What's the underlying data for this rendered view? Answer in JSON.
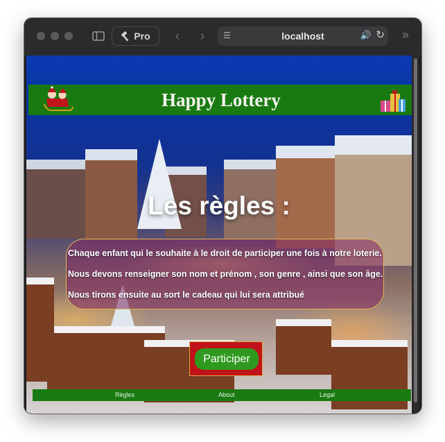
{
  "browser": {
    "toolbar_button_label": "Pro",
    "address": "localhost"
  },
  "page": {
    "header_title": "Happy Lottery",
    "rules_title": "Les règles :",
    "rules": [
      "Chaque enfant qui le souhaite à le droit de participer une fois à notre loterie.",
      "Nous devons renseigner son nom et prénom , son genre , ainsi que son âge.",
      "Nous tirons ensuite au sort le cadeau qui lui sera attribué"
    ],
    "participate_label": "Participer",
    "footer_links": [
      "Règles",
      "About",
      "Legal"
    ]
  },
  "colors": {
    "header_green": "#1a7a12",
    "button_green": "#2f9a1f",
    "button_frame_red": "#c0121b"
  },
  "icons": [
    "sidebar-icon",
    "hammer-icon",
    "chevron-left-icon",
    "chevron-right-icon",
    "page-icon",
    "speaker-icon",
    "reload-icon",
    "double-chevron-icon",
    "santa-sleigh-icon",
    "gift-boxes-icon"
  ]
}
